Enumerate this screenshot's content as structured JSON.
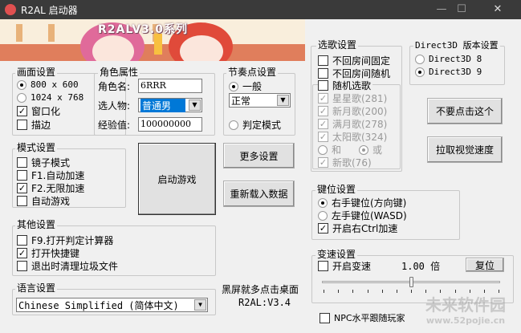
{
  "window": {
    "title": "R2AL 启动器",
    "min": "—",
    "max": "☐",
    "close": "✕"
  },
  "banner": {
    "logo_text": "R2ALV3.0系列"
  },
  "display": {
    "title": "画面设置",
    "res1": "800 x 600",
    "res2": "1024 x 768",
    "windowed": "窗口化",
    "outline": "描边",
    "res_selected": "800 x 600",
    "windowed_checked": true,
    "outline_checked": false
  },
  "character": {
    "title": "角色属性",
    "name_label": "角色名:",
    "name_value": "6RRR",
    "pick_label": "选人物:",
    "pick_value": "普通男",
    "exp_label": "经验值:",
    "exp_value": "100000000"
  },
  "rhythm": {
    "title": "节奏点设置",
    "normal": "一般",
    "speed_value": "正常",
    "judge": "判定模式"
  },
  "song": {
    "title": "选歌设置",
    "no_return_fixed": "不回房间固定",
    "no_return_random": "不回房间随机",
    "random": "随机选歌",
    "star": "星星歌(281)",
    "newmoon": "新月歌(200)",
    "fullmoon": "满月歌(278)",
    "sun": "太阳歌(324)",
    "and": "和",
    "or": "或",
    "new": "新歌(76)"
  },
  "d3d": {
    "title": "Direct3D 版本设置",
    "v8": "Direct3D 8",
    "v9": "Direct3D 9",
    "selected": "Direct3D 9"
  },
  "buttons": {
    "dont_click": "不要点击这个",
    "pull_speed": "拉取视觉速度",
    "start": "启动游戏",
    "more": "更多设置",
    "reload": "重新载入数据",
    "reset": "复位"
  },
  "mode": {
    "title": "模式设置",
    "mirror": "镜子模式",
    "f1": "F1.自动加速",
    "f2": "F2.无限加速",
    "auto": "自动游戏",
    "f2_checked": true
  },
  "other": {
    "title": "其他设置",
    "f9": "F9.打开判定计算器",
    "hotkey": "打开快捷键",
    "cleanup": "退出时清理垃圾文件",
    "hotkey_checked": true
  },
  "language": {
    "title": "语言设置",
    "value": "Chinese Simplified (简体中文)"
  },
  "info": {
    "tip": "黑屏就多点击桌面",
    "version": "R2AL:V3.4"
  },
  "keys": {
    "title": "键位设置",
    "right": "右手键位(方向键)",
    "left": "左手键位(WASD)",
    "ctrl": "开启右Ctrl加速",
    "ctrl_checked": true
  },
  "speed": {
    "title": "变速设置",
    "enable": "开启变速",
    "value": "1.00 倍",
    "slider_fraction": 0.5
  },
  "npc": {
    "label": "NPC水平跟随玩家"
  },
  "watermark": {
    "text": "未来软件园",
    "url": "www.52pojie.cn"
  }
}
